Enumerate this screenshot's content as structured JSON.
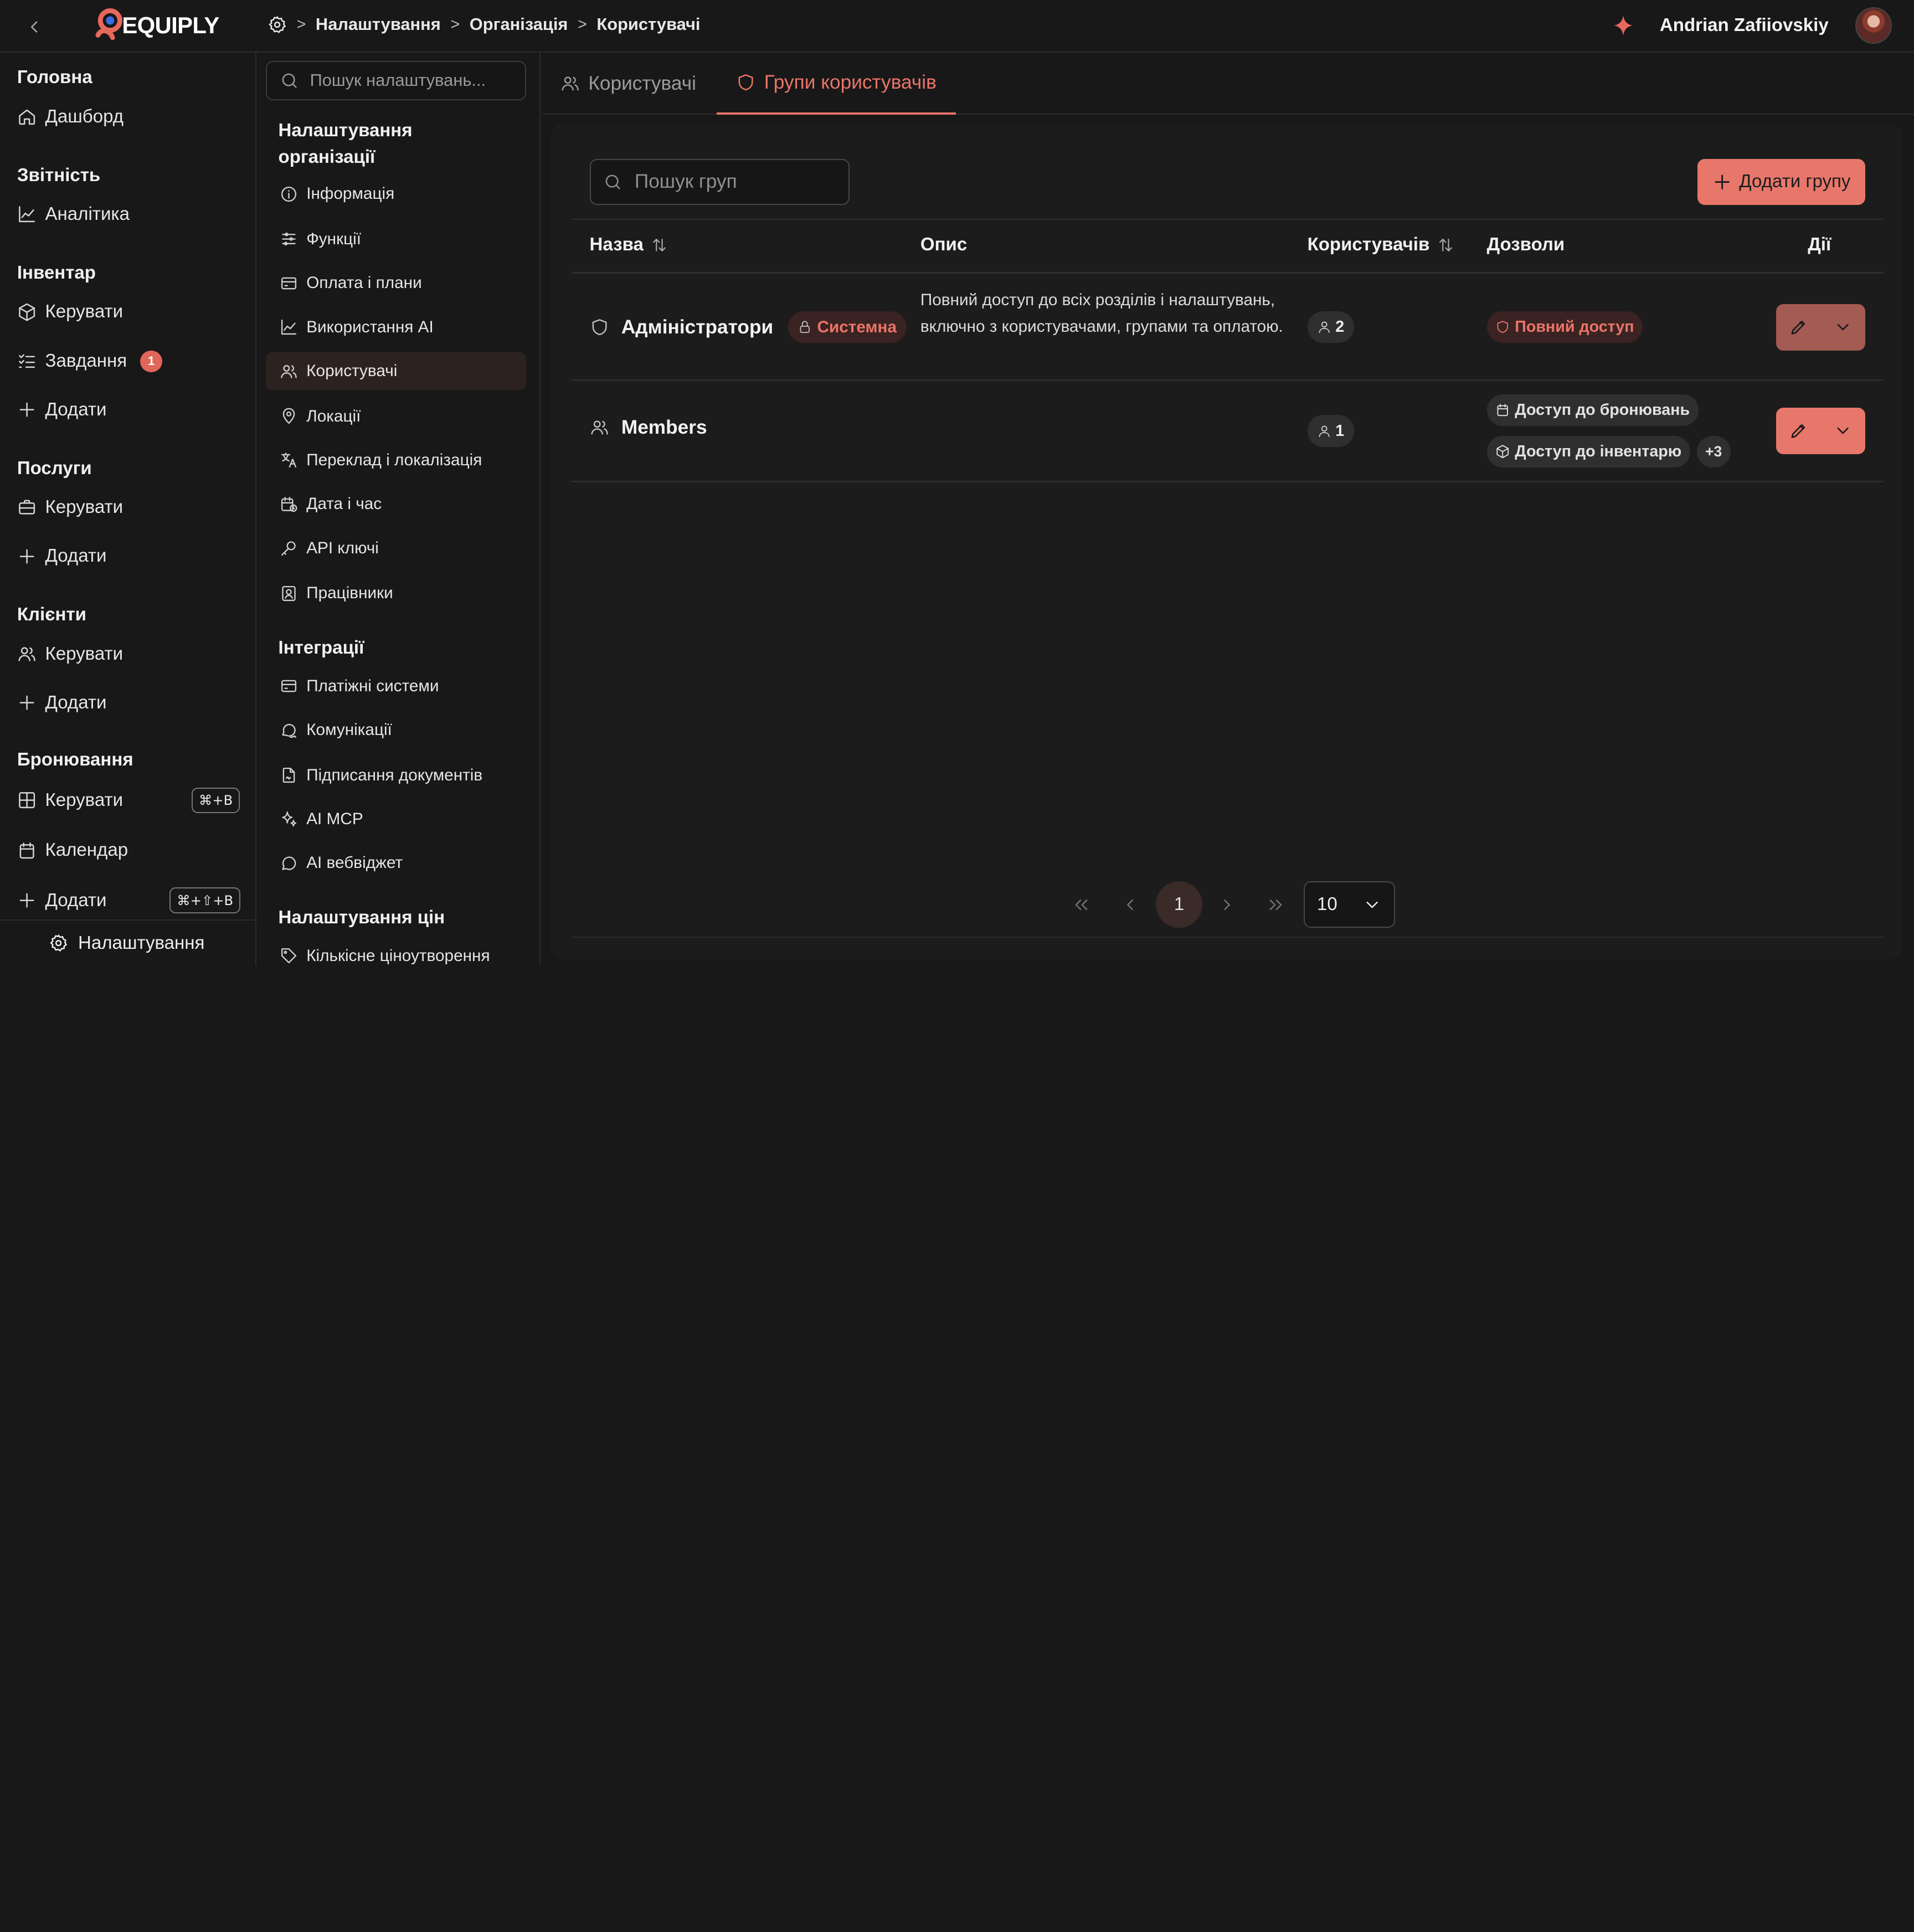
{
  "topbar": {
    "logo_text": "EQUIPLY",
    "breadcrumbs": [
      "Налаштування",
      "Організація",
      "Користувачі"
    ],
    "user_name": "Andrian Zafiiovskiy"
  },
  "sidebar": {
    "sections": [
      {
        "title": "Головна",
        "items": [
          {
            "label": "Дашборд",
            "icon": "home-icon"
          }
        ]
      },
      {
        "title": "Звітність",
        "items": [
          {
            "label": "Аналітика",
            "icon": "chart-icon"
          }
        ]
      },
      {
        "title": "Інвентар",
        "items": [
          {
            "label": "Керувати",
            "icon": "box-icon"
          },
          {
            "label": "Завдання",
            "icon": "list-icon",
            "badge": "1"
          },
          {
            "label": "Додати",
            "icon": "plus-icon"
          }
        ]
      },
      {
        "title": "Послуги",
        "items": [
          {
            "label": "Керувати",
            "icon": "briefcase-icon"
          },
          {
            "label": "Додати",
            "icon": "plus-icon"
          }
        ]
      },
      {
        "title": "Клієнти",
        "items": [
          {
            "label": "Керувати",
            "icon": "users-icon"
          },
          {
            "label": "Додати",
            "icon": "plus-icon"
          }
        ]
      },
      {
        "title": "Бронювання",
        "items": [
          {
            "label": "Керувати",
            "icon": "grid-icon",
            "shortcut": "⌘+B"
          },
          {
            "label": "Календар",
            "icon": "calendar-icon"
          },
          {
            "label": "Додати",
            "icon": "plus-icon",
            "shortcut": "⌘+⇧+B"
          }
        ]
      }
    ],
    "footer_label": "Налаштування"
  },
  "settings_nav": {
    "search_placeholder": "Пошук налаштувань...",
    "org_heading_line1": "Налаштування",
    "org_heading_line2": "організації",
    "org_items": [
      "Інформація",
      "Функції",
      "Оплата і плани",
      "Використання AI",
      "Користувачі",
      "Локації",
      "Переклад і локалізація",
      "Дата і час",
      "API ключі",
      "Працівники"
    ],
    "integrations_heading": "Інтеграції",
    "integration_items": [
      "Платіжні системи",
      "Комунікації",
      "Підписання документів",
      "AI MCP",
      "AI вебвіджет"
    ],
    "pricing_heading": "Налаштування цін",
    "pricing_items": [
      "Кількісне ціноутворення"
    ]
  },
  "main": {
    "tabs": [
      {
        "label": "Користувачі"
      },
      {
        "label": "Групи користувачів"
      }
    ],
    "search_placeholder": "Пошук груп",
    "add_button": "Додати групу",
    "columns": {
      "name": "Назва",
      "description": "Опис",
      "users": "Користувачів",
      "permissions": "Дозволи",
      "actions": "Дії"
    },
    "rows": [
      {
        "name": "Адміністратори",
        "badge": "Системна",
        "description": "Повний доступ до всіх розділів і налаштувань, включно з користувачами, групами та оплатою.",
        "users": "2",
        "permissions": [
          "Повний доступ"
        ]
      },
      {
        "name": "Members",
        "description": "",
        "users": "1",
        "permissions": [
          "Доступ до бронювань",
          "Доступ до інвентарю"
        ],
        "more": "+3"
      }
    ],
    "pagination": {
      "current_page": "1",
      "page_size": "10"
    }
  },
  "colors": {
    "accent": "#e8776b",
    "background": "#181818",
    "card": "#1c1c1c",
    "badge_bg": "#3a2322"
  }
}
